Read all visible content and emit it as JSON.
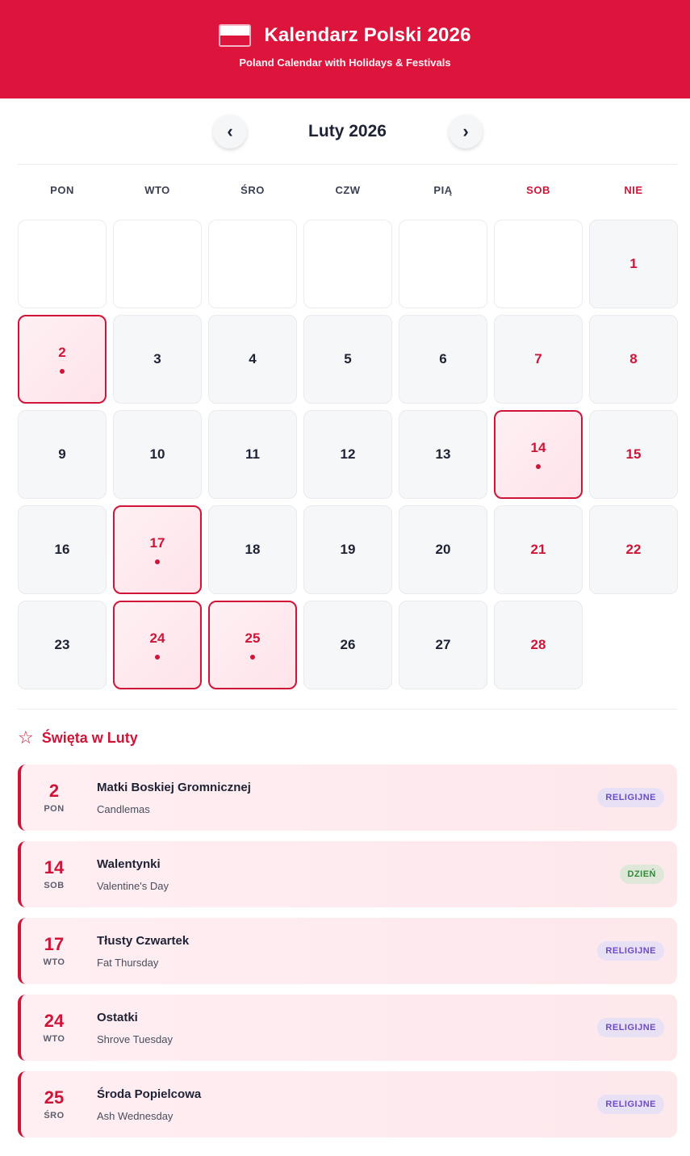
{
  "header": {
    "title": "Kalendarz Polski 2026",
    "subtitle": "Poland Calendar with Holidays & Festivals",
    "flag_colors": [
      "#ffffff",
      "#dd143c"
    ]
  },
  "nav": {
    "prev_icon": "‹",
    "next_icon": "›",
    "month_title": "Luty 2026"
  },
  "weekdays": [
    "PON",
    "WTO",
    "ŚRO",
    "CZW",
    "PIĄ",
    "SOB",
    "NIE"
  ],
  "weeks": [
    [
      {
        "day": "",
        "type": "blank"
      },
      {
        "day": "",
        "type": "blank"
      },
      {
        "day": "",
        "type": "blank"
      },
      {
        "day": "",
        "type": "blank"
      },
      {
        "day": "",
        "type": "blank"
      },
      {
        "day": "",
        "type": "blank"
      },
      {
        "day": "1",
        "type": "weekend"
      }
    ],
    [
      {
        "day": "2",
        "type": "holiday"
      },
      {
        "day": "3",
        "type": "normal"
      },
      {
        "day": "4",
        "type": "normal"
      },
      {
        "day": "5",
        "type": "normal"
      },
      {
        "day": "6",
        "type": "normal"
      },
      {
        "day": "7",
        "type": "weekend"
      },
      {
        "day": "8",
        "type": "weekend"
      }
    ],
    [
      {
        "day": "9",
        "type": "normal"
      },
      {
        "day": "10",
        "type": "normal"
      },
      {
        "day": "11",
        "type": "normal"
      },
      {
        "day": "12",
        "type": "normal"
      },
      {
        "day": "13",
        "type": "normal"
      },
      {
        "day": "14",
        "type": "holiday"
      },
      {
        "day": "15",
        "type": "weekend"
      }
    ],
    [
      {
        "day": "16",
        "type": "normal"
      },
      {
        "day": "17",
        "type": "holiday"
      },
      {
        "day": "18",
        "type": "normal"
      },
      {
        "day": "19",
        "type": "normal"
      },
      {
        "day": "20",
        "type": "normal"
      },
      {
        "day": "21",
        "type": "weekend"
      },
      {
        "day": "22",
        "type": "weekend"
      }
    ],
    [
      {
        "day": "23",
        "type": "normal"
      },
      {
        "day": "24",
        "type": "holiday"
      },
      {
        "day": "25",
        "type": "holiday"
      },
      {
        "day": "26",
        "type": "normal"
      },
      {
        "day": "27",
        "type": "normal"
      },
      {
        "day": "28",
        "type": "weekend"
      },
      {
        "day": "",
        "type": "empty"
      }
    ]
  ],
  "holidays_section": {
    "title": "Święta w  Luty",
    "icon": "star-icon",
    "items": [
      {
        "day": "2",
        "weekday": "PON",
        "name": "Matki Boskiej Gromnicznej",
        "english": "Candlemas",
        "badge": "RELIGIJNE",
        "badge_type": "rel"
      },
      {
        "day": "14",
        "weekday": "SOB",
        "name": "Walentynki",
        "english": "Valentine's Day",
        "badge": "DZIEŃ",
        "badge_type": "day"
      },
      {
        "day": "17",
        "weekday": "WTO",
        "name": "Tłusty Czwartek",
        "english": "Fat Thursday",
        "badge": "RELIGIJNE",
        "badge_type": "rel"
      },
      {
        "day": "24",
        "weekday": "WTO",
        "name": "Ostatki",
        "english": "Shrove Tuesday",
        "badge": "RELIGIJNE",
        "badge_type": "rel"
      },
      {
        "day": "25",
        "weekday": "ŚRO",
        "name": "Środa Popielcowa",
        "english": "Ash Wednesday",
        "badge": "RELIGIJNE",
        "badge_type": "rel"
      }
    ]
  },
  "colors": {
    "primary_red": "#dd143c",
    "accent_red": "#d01437",
    "religious_badge_bg": "#e8e0f5",
    "religious_badge_text": "#6c4cc4",
    "day_badge_bg": "#dfe8d8",
    "day_badge_text": "#2f8a3a"
  }
}
